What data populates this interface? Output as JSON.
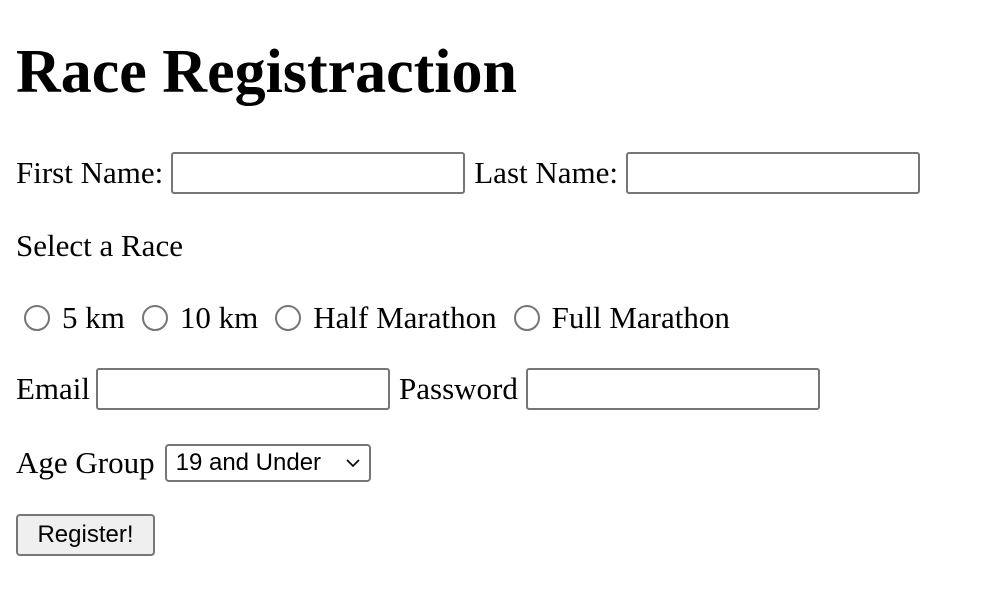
{
  "page": {
    "title": "Race Registraction"
  },
  "form": {
    "first_name_label": "First Name:",
    "first_name_value": "",
    "last_name_label": "Last Name:",
    "last_name_value": "",
    "race_heading": "Select a Race",
    "races": [
      {
        "label": "5 km",
        "selected": false
      },
      {
        "label": "10 km",
        "selected": false
      },
      {
        "label": "Half Marathon",
        "selected": false
      },
      {
        "label": "Full Marathon",
        "selected": false
      }
    ],
    "email_label": "Email",
    "email_value": "",
    "password_label": "Password",
    "password_value": "",
    "age_group_label": "Age Group",
    "age_group_selected": "19 and Under",
    "age_group_icon": "chevron-down-icon",
    "submit_label": "Register!"
  },
  "colors": {
    "control_border": "#767676",
    "button_bg": "#efefef",
    "text": "#000000",
    "background": "#ffffff"
  }
}
